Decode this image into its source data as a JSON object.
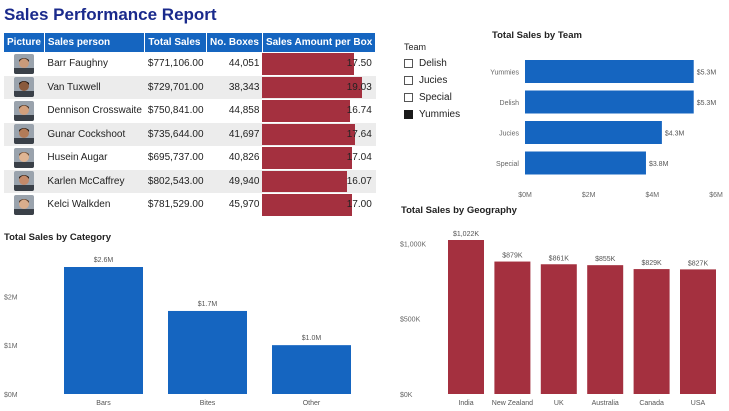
{
  "report_title": "Sales Performance Report",
  "table": {
    "headers": [
      "Picture",
      "Sales person",
      "Total Sales",
      "No. Boxes",
      "Sales Amount per Box"
    ],
    "rows": [
      {
        "name": "Barr Faughny",
        "total": "$771,106.00",
        "boxes": "44,051",
        "per_box": "17.50",
        "per_box_value": 17.5
      },
      {
        "name": "Van Tuxwell",
        "total": "$729,701.00",
        "boxes": "38,343",
        "per_box": "19.03",
        "per_box_value": 19.03
      },
      {
        "name": "Dennison Crosswaite",
        "total": "$750,841.00",
        "boxes": "44,858",
        "per_box": "16.74",
        "per_box_value": 16.74
      },
      {
        "name": "Gunar Cockshoot",
        "total": "$735,644.00",
        "boxes": "41,697",
        "per_box": "17.64",
        "per_box_value": 17.64
      },
      {
        "name": "Husein Augar",
        "total": "$695,737.00",
        "boxes": "40,826",
        "per_box": "17.04",
        "per_box_value": 17.04
      },
      {
        "name": "Karlen McCaffrey",
        "total": "$802,543.00",
        "boxes": "49,940",
        "per_box": "16.07",
        "per_box_value": 16.07
      },
      {
        "name": "Kelci Walkden",
        "total": "$781,529.00",
        "boxes": "45,970",
        "per_box": "17.00",
        "per_box_value": 17.0
      }
    ]
  },
  "legend": {
    "title": "Team",
    "items": [
      {
        "label": "Delish",
        "checked": false
      },
      {
        "label": "Jucies",
        "checked": false
      },
      {
        "label": "Special",
        "checked": false
      },
      {
        "label": "Yummies",
        "checked": true
      }
    ]
  },
  "colors": {
    "blue": "#1565c0",
    "red": "#a4303f",
    "header_blue": "#1565c0",
    "title_navy": "#1a2a8c"
  },
  "chart_data": [
    {
      "type": "bar",
      "orientation": "horizontal",
      "title": "Total Sales by Team",
      "categories": [
        "Yummies",
        "Delish",
        "Jucies",
        "Special"
      ],
      "values": [
        5.3,
        5.3,
        4.3,
        3.8
      ],
      "data_labels": [
        "$5.3M",
        "$5.3M",
        "$4.3M",
        "$3.8M"
      ],
      "xlim": [
        0,
        6
      ],
      "x_ticks": [
        "$0M",
        "$2M",
        "$4M",
        "$6M"
      ],
      "color": "#1565c0"
    },
    {
      "type": "bar",
      "title": "Total Sales by Category",
      "categories": [
        "Bars",
        "Bites",
        "Other"
      ],
      "values": [
        2.6,
        1.7,
        1.0
      ],
      "data_labels": [
        "$2.6M",
        "$1.7M",
        "$1.0M"
      ],
      "ylim": [
        0,
        2.6
      ],
      "y_ticks": [
        "$0M",
        "$1M",
        "$2M"
      ],
      "color": "#1565c0"
    },
    {
      "type": "bar",
      "title": "Total Sales by Geography",
      "categories": [
        "India",
        "New Zealand",
        "UK",
        "Australia",
        "Canada",
        "USA"
      ],
      "values": [
        1022,
        879,
        861,
        855,
        829,
        827
      ],
      "data_labels": [
        "$1,022K",
        "$879K",
        "$861K",
        "$855K",
        "$829K",
        "$827K"
      ],
      "ylim": [
        0,
        1022
      ],
      "y_ticks": [
        "$0K",
        "$500K",
        "$1,000K"
      ],
      "color": "#a4303f"
    }
  ]
}
